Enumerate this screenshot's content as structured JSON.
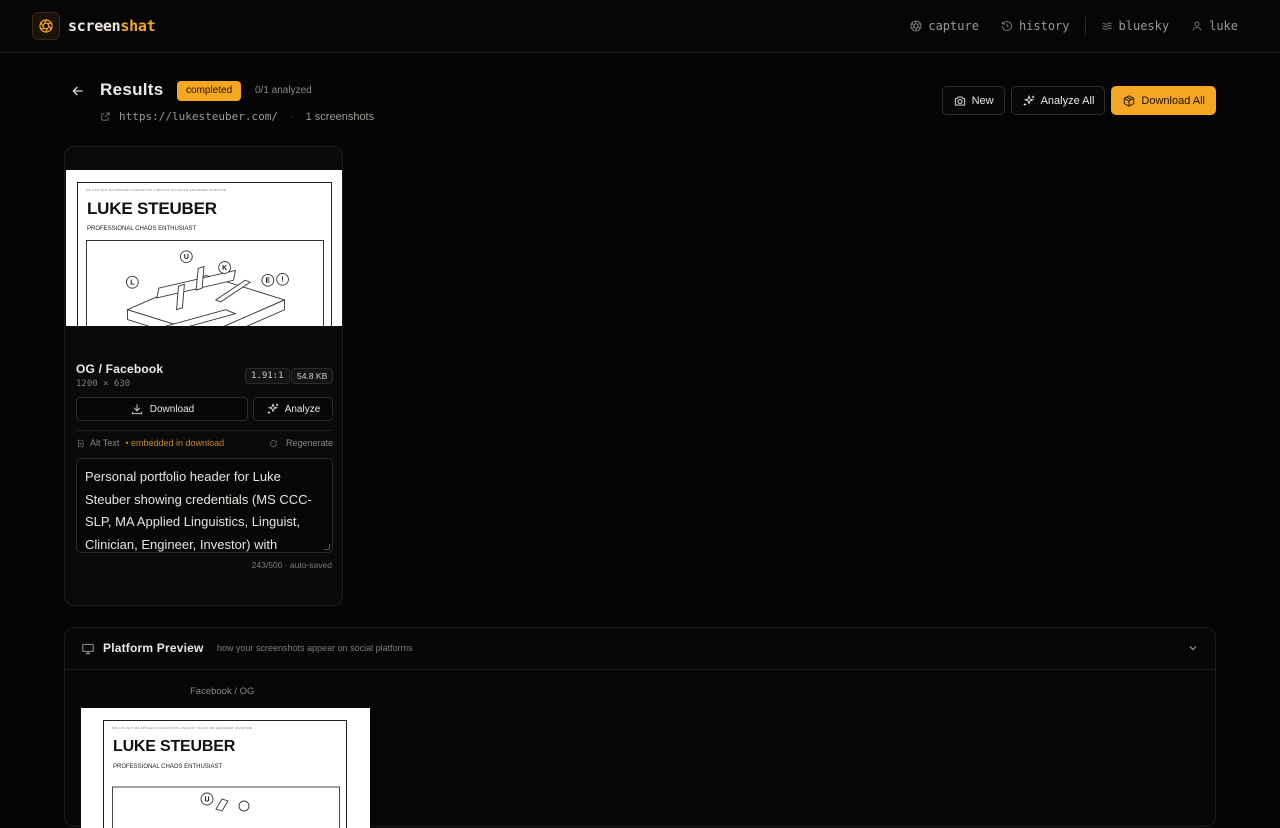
{
  "app": {
    "name_a": "screen",
    "name_b": "shat",
    "accent": "#f5a623"
  },
  "nav": {
    "items": [
      {
        "label": "capture",
        "icon": "aperture-icon"
      },
      {
        "label": "history",
        "icon": "history-icon"
      },
      {
        "label": "bluesky",
        "icon": "bluesky-icon"
      },
      {
        "label": "luke",
        "icon": "user-icon"
      }
    ]
  },
  "header": {
    "title": "Results",
    "status": "completed",
    "analyzed": "0/1 analyzed",
    "url": "https://lukesteuber.com/",
    "count": "1 screenshots"
  },
  "actions": {
    "new": "New",
    "analyze_all": "Analyze All",
    "download_all": "Download All"
  },
  "card": {
    "thumb": {
      "name": "LUKE STEUBER",
      "tagline": "PROFESSIONAL CHAOS ENTHUSIAST",
      "tiny": "MS CCC-SLP   MA APPLIED LINGUISTICS   LINGUIST   CLINICIAN   ENGINEER   INVESTOR",
      "labels": [
        "U",
        "K",
        "L",
        "E",
        "!"
      ]
    },
    "title": "OG / Facebook",
    "dims": "1200 × 630",
    "ratio": "1.91:1",
    "size": "54.8 KB",
    "download": "Download",
    "analyze": "Analyze",
    "alt_label": "Alt Text",
    "embedded": "• embedded in download",
    "regenerate": "Regenerate",
    "alt_text": "Personal portfolio header for Luke Steuber showing credentials (MS CCC-SLP, MA Applied Linguistics, Linguist, Clinician, Engineer, Investor) with",
    "char_count": "243/500 · auto-saved"
  },
  "preview": {
    "title": "Platform Preview",
    "subtitle": "how your screenshots appear on social platforms",
    "fb_label": "Facebook / OG"
  }
}
